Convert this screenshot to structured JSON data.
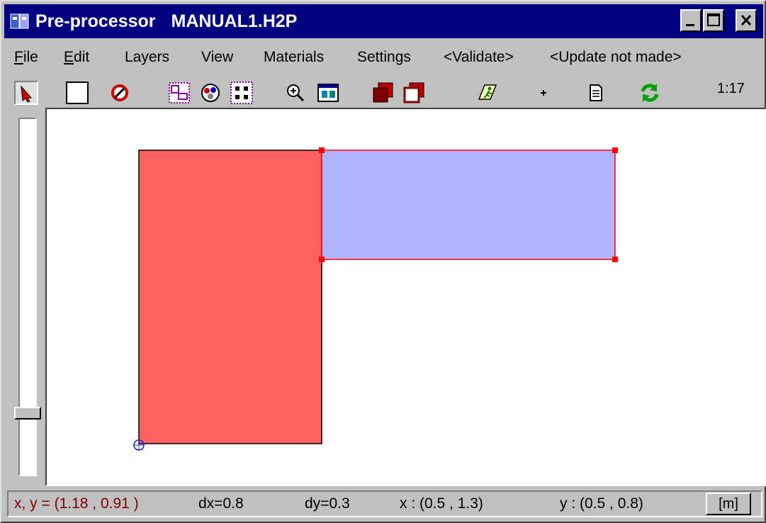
{
  "window": {
    "title": "Pre-processor",
    "document": "MANUAL1.H2P"
  },
  "menu": {
    "file": {
      "mnemonic": "F",
      "rest": "ile"
    },
    "edit": {
      "mnemonic": "E",
      "rest": "dit"
    },
    "layers": "Layers",
    "view": "View",
    "materials": "Materials",
    "settings": "Settings",
    "validate": "<Validate>",
    "update": "<Update not made>"
  },
  "toolbar": {
    "scale": "1:17",
    "icons": [
      "select-arrow-icon",
      "rectangle-icon",
      "no-entry-icon",
      "window-select-icon",
      "materials-palette-icon",
      "grid-points-icon",
      "zoom-icon",
      "view-window-icon",
      "bring-front-icon",
      "send-back-icon",
      "run-icon",
      "plus-icon",
      "page-icon",
      "refresh-icon"
    ]
  },
  "status": {
    "cursor": "x, y = (1.18 , 0.91 )",
    "dx": "dx=0.8",
    "dy": "dy=0.3",
    "x_range": "x : (0.5 , 1.3)",
    "y_range": "y : (0.5 , 0.8)",
    "unit": "[m]"
  },
  "colors": {
    "titlebar": "#000080",
    "red_rect": "#ff6060",
    "blue_rect": "#b0b4ff",
    "selection": "#ff0000"
  }
}
